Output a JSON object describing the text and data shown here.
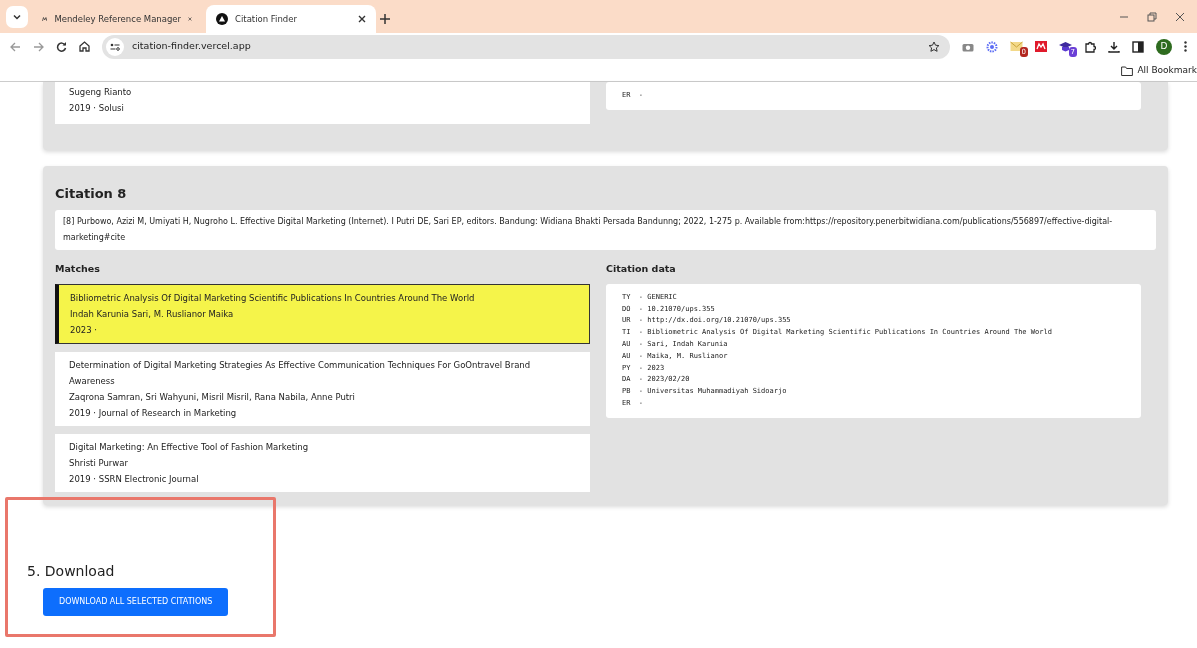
{
  "browser": {
    "tabs": [
      {
        "title": "Mendeley Reference Manager",
        "selected": false
      },
      {
        "title": "Citation Finder",
        "selected": true
      }
    ],
    "address": "citation-finder.vercel.app",
    "extension_badges": [
      "0",
      "7"
    ],
    "avatar": "D",
    "bookmarks": [
      "All Bookmark"
    ]
  },
  "previous_citation": {
    "match": {
      "authors": "Sugeng Rianto",
      "meta": "2019 · Solusi"
    },
    "citation_data": [
      "ER  -"
    ]
  },
  "citation": {
    "title": "Citation 8",
    "text": "[8]   Purbowo, Azizi M, Umiyati H, Nugroho L. Effective Digital Marketing (Internet). I Putri DE, Sari EP, editors. Bandung: Widiana Bhakti Persada Bandunng; 2022, 1-275 p. Available from:https://repository.penerbitwidiana.com/publications/556897/effective-digital- marketing#cite",
    "matches_label": "Matches",
    "data_label": "Citation data",
    "matches": [
      {
        "title": "Bibliometric Analysis Of Digital Marketing Scientific Publications In Countries Around The World",
        "authors": "Indah Karunia Sari, M. Ruslianor Maika",
        "meta": "2023 ·",
        "selected": true
      },
      {
        "title": "Determination of Digital Marketing Strategies As Effective Communication Techniques For GoOntravel Brand Awareness",
        "authors": "Zaqrona Samran, Sri Wahyuni, Misril Misril, Rana Nabila, Anne Putri",
        "meta": "2019 · Journal of Research in Marketing",
        "selected": false
      },
      {
        "title": "Digital Marketing: An Effective Tool of Fashion Marketing",
        "authors": "Shristi Purwar",
        "meta": "2019 · SSRN Electronic Journal",
        "selected": false
      }
    ],
    "citation_data": [
      "TY  - GENERIC",
      "DO  - 10.21070/ups.355",
      "UR  - http://dx.doi.org/10.21070/ups.355",
      "TI  - Bibliometric Analysis Of Digital Marketing Scientific Publications In Countries Around The World",
      "AU  - Sari, Indah Karunia",
      "AU  - Maika, M. Ruslianor",
      "PY  - 2023",
      "DA  - 2023/02/20",
      "PB  - Universitas Muhammadiyah Sidoarjo",
      "ER  -"
    ]
  },
  "download": {
    "heading": "5. Download",
    "button": "DOWNLOAD ALL SELECTED CITATIONS"
  }
}
